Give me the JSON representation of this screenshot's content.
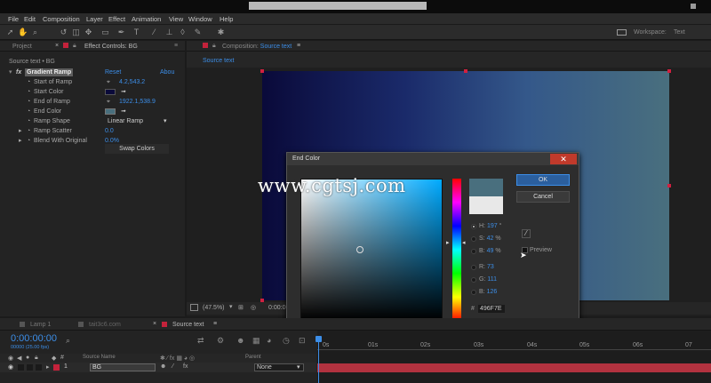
{
  "menu": [
    "File",
    "Edit",
    "Composition",
    "Layer",
    "Effect",
    "Animation",
    "View",
    "Window",
    "Help"
  ],
  "workspace": {
    "label": "Workspace:",
    "value": "Text"
  },
  "project_tab": "Project",
  "effect_controls": {
    "tab_label": "Effect Controls: BG",
    "breadcrumb": "Source text • BG",
    "effect_name": "Gradient Ramp",
    "reset": "Reset",
    "about": "Abou",
    "props": [
      {
        "label": "Start of Ramp",
        "value": "4.2,543.2"
      },
      {
        "label": "Start Color",
        "value": ""
      },
      {
        "label": "End of Ramp",
        "value": "1922.1,538.9"
      },
      {
        "label": "End Color",
        "value": ""
      },
      {
        "label": "Ramp Shape",
        "value": "Linear Ramp"
      },
      {
        "label": "Ramp Scatter",
        "value": "0.0"
      },
      {
        "label": "Blend With Original",
        "value": "0.0%"
      }
    ],
    "swap": "Swap Colors"
  },
  "composition": {
    "tab_label": "Composition: Source text",
    "sub_tab": "Source text",
    "zoom": "(47.5%)",
    "time": "0:00:00:"
  },
  "color_dialog": {
    "title": "End Color",
    "ok": "OK",
    "cancel": "Cancel",
    "fields": [
      {
        "label": "H:",
        "value": "197",
        "unit": "°"
      },
      {
        "label": "S:",
        "value": "42",
        "unit": "%"
      },
      {
        "label": "B:",
        "value": "49",
        "unit": "%"
      },
      {
        "label": "R:",
        "value": "73",
        "unit": ""
      },
      {
        "label": "G:",
        "value": "111",
        "unit": ""
      },
      {
        "label": "B:",
        "value": "126",
        "unit": ""
      }
    ],
    "hex_label": "#",
    "hex": "496F7E",
    "preview": "Preview",
    "new_color": "#496F7E",
    "old_color": "#e8e8e8"
  },
  "watermark": "www.cgtsj.com",
  "timeline": {
    "tabs": [
      "Lamp 1",
      "tait3c6.com",
      "Source text"
    ],
    "timecode": "0:00:00:00",
    "fps": "00000 (25.00 fps)",
    "col_source": "Source Name",
    "col_parent": "Parent",
    "layer_num": "1",
    "layer_name": "BG",
    "parent_value": "None",
    "ruler": [
      "0s",
      "01s",
      "02s",
      "03s",
      "04s",
      "05s",
      "06s",
      "07"
    ]
  },
  "colors": {
    "accent": "#3c8ee8",
    "red": "#c4223b",
    "end_color": "#496F7E",
    "start_color": "#0a0a3a"
  }
}
